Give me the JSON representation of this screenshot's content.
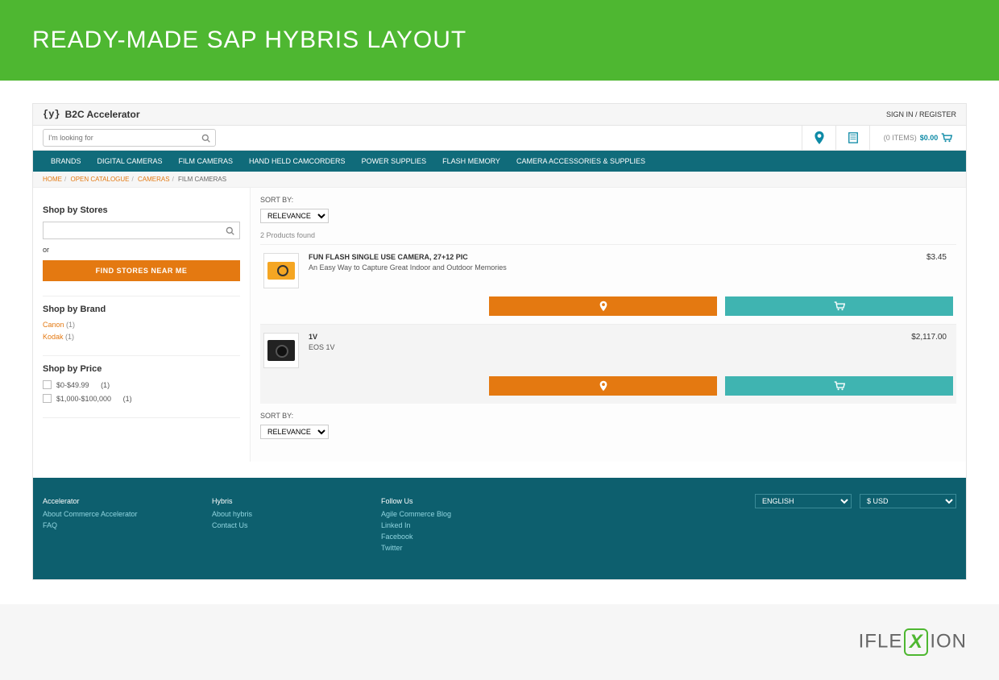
{
  "banner_title": "READY-MADE SAP HYBRIS LAYOUT",
  "brand": "B2C Accelerator",
  "signin": "SIGN IN / REGISTER",
  "search_placeholder": "I'm looking for",
  "cart": {
    "items_label": "(0 ITEMS)",
    "total": "$0.00"
  },
  "nav": [
    "BRANDS",
    "DIGITAL CAMERAS",
    "FILM CAMERAS",
    "HAND HELD CAMCORDERS",
    "POWER SUPPLIES",
    "FLASH MEMORY",
    "CAMERA ACCESSORIES & SUPPLIES"
  ],
  "breadcrumb": {
    "home": "HOME",
    "cat": "OPEN CATALOGUE",
    "sub": "CAMERAS",
    "current": "FILM CAMERAS"
  },
  "facets": {
    "stores_title": "Shop by Stores",
    "or": "or",
    "find_btn": "FIND STORES NEAR ME",
    "brand_title": "Shop by Brand",
    "brands": [
      {
        "name": "Canon",
        "count": "(1)"
      },
      {
        "name": "Kodak",
        "count": "(1)"
      }
    ],
    "price_title": "Shop by Price",
    "prices": [
      {
        "label": "$0-$49.99",
        "count": "(1)"
      },
      {
        "label": "$1,000-$100,000",
        "count": "(1)"
      }
    ]
  },
  "sort_label": "SORT BY:",
  "sort_value": "RELEVANCE",
  "found": "2 Products found",
  "products": [
    {
      "name": "FUN FLASH SINGLE USE CAMERA, 27+12 PIC",
      "desc": "An Easy Way to Capture Great Indoor and Outdoor Memories",
      "price": "$3.45"
    },
    {
      "name": "1V",
      "desc": "EOS 1V",
      "price": "$2,117.00"
    }
  ],
  "footer": {
    "col1": {
      "head": "Accelerator",
      "links": [
        "About Commerce Accelerator",
        "FAQ"
      ]
    },
    "col2": {
      "head": "Hybris",
      "links": [
        "About hybris",
        "Contact Us"
      ]
    },
    "col3": {
      "head": "Follow Us",
      "links": [
        "Agile Commerce Blog",
        "Linked In",
        "Facebook",
        "Twitter"
      ]
    },
    "language": "ENGLISH",
    "currency": "$ USD"
  },
  "vendor": {
    "pre": "IFLE",
    "post": "ION"
  }
}
